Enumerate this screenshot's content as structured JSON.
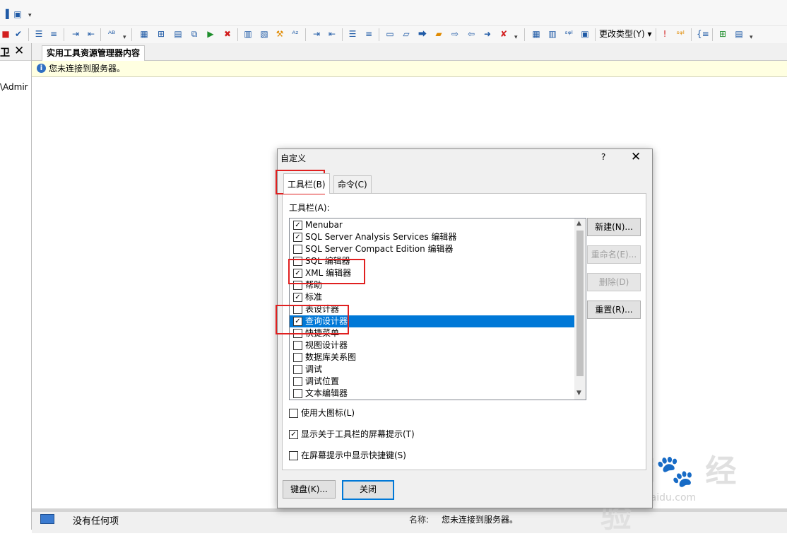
{
  "toolbar": {
    "change_type_label": "更改类型(Y)"
  },
  "left_pane": {
    "path_fragment": "\\Admir"
  },
  "document": {
    "tab_title": "实用工具资源管理器内容",
    "info_message": "您未连接到服务器。"
  },
  "status_bar": {
    "no_items": "没有任何项",
    "name_label": "名称:",
    "name_value": "您未连接到服务器。"
  },
  "dialog": {
    "title": "自定义",
    "help": "?",
    "close": "✕",
    "tabs": {
      "toolbars": "工具栏(B)",
      "commands": "命令(C)"
    },
    "list_label": "工具栏(A):",
    "toolbars": [
      {
        "label": "Menubar",
        "checked": true,
        "mark": "✓"
      },
      {
        "label": "SQL Server Analysis Services 编辑器",
        "checked": true,
        "mark": "✓"
      },
      {
        "label": "SQL Server Compact Edition 编辑器",
        "checked": false,
        "mark": ""
      },
      {
        "label": "SQL 编辑器",
        "checked": false,
        "mark": ""
      },
      {
        "label": "XML 编辑器",
        "checked": true,
        "mark": "✓"
      },
      {
        "label": "帮助",
        "checked": false,
        "mark": ""
      },
      {
        "label": "标准",
        "checked": true,
        "mark": "✓"
      },
      {
        "label": "表设计器",
        "checked": false,
        "mark": ""
      },
      {
        "label": "查询设计器",
        "checked": true,
        "mark": "✓",
        "selected": true
      },
      {
        "label": "快捷菜单",
        "checked": false,
        "mark": ""
      },
      {
        "label": "视图设计器",
        "checked": false,
        "mark": ""
      },
      {
        "label": "数据库关系图",
        "checked": false,
        "mark": ""
      },
      {
        "label": "调试",
        "checked": false,
        "mark": ""
      },
      {
        "label": "调试位置",
        "checked": false,
        "mark": ""
      },
      {
        "label": "文本编辑器",
        "checked": false,
        "mark": ""
      }
    ],
    "buttons": {
      "new": "新建(N)...",
      "rename": "重命名(E)...",
      "delete": "删除(D)",
      "reset": "重置(R)...",
      "keyboard": "键盘(K)...",
      "close": "关闭"
    },
    "options": {
      "large_icons": {
        "label": "使用大图标(L)",
        "mark": ""
      },
      "show_tooltips": {
        "label": "显示关于工具栏的屏幕提示(T)",
        "mark": "✓"
      },
      "show_shortcuts": {
        "label": "在屏幕提示中显示快捷键(S)",
        "mark": ""
      }
    }
  },
  "watermark": {
    "logo": "Bai du 经验",
    "url": "jingyan.baidu.com"
  }
}
